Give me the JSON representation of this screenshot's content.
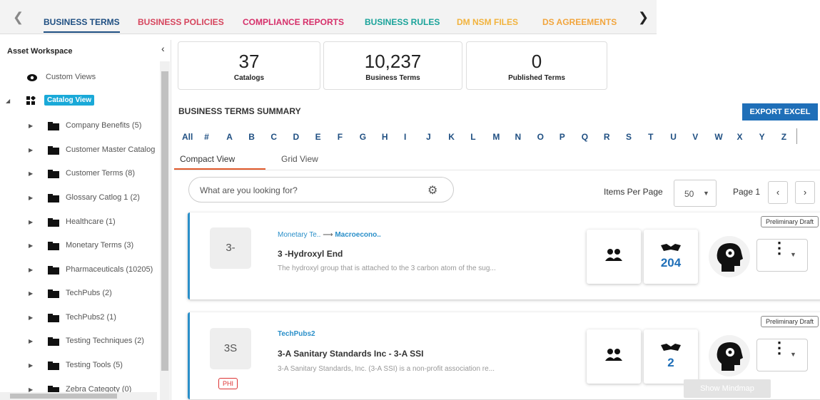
{
  "tabs": [
    {
      "label": "BUSINESS TERMS",
      "color": "#1f4f82"
    },
    {
      "label": "BUSINESS POLICIES",
      "color": "#d6455d"
    },
    {
      "label": "COMPLIANCE REPORTS",
      "color": "#d6306a"
    },
    {
      "label": "BUSINESS RULES",
      "color": "#1aa39a"
    },
    {
      "label": "DM NSM FILES",
      "color": "#f2b33d"
    },
    {
      "label": "DS AGREEMENTS",
      "color": "#f2a53d"
    }
  ],
  "sidebar": {
    "title": "Asset Workspace",
    "custom_views": "Custom Views",
    "catalog_view": "Catalog View",
    "items": [
      "Company Benefits (5)",
      "Customer Master Catalog",
      "Customer Terms (8)",
      "Glossary Catlog 1 (2)",
      "Healthcare (1)",
      "Monetary Terms (3)",
      "Pharmaceuticals (10205)",
      "TechPubs (2)",
      "TechPubs2 (1)",
      "Testing Techniques (2)",
      "Testing Tools (5)",
      "Zebra Categoty (0)"
    ]
  },
  "stats": [
    {
      "value": "37",
      "label": "Catalogs"
    },
    {
      "value": "10,237",
      "label": "Business Terms"
    },
    {
      "value": "0",
      "label": "Published Terms"
    }
  ],
  "summary": {
    "title": "BUSINESS TERMS SUMMARY",
    "export_label": "EXPORT EXCEL"
  },
  "alphabet": [
    "All",
    "#",
    "A",
    "B",
    "C",
    "D",
    "E",
    "F",
    "G",
    "H",
    "I",
    "J",
    "K",
    "L",
    "M",
    "N",
    "O",
    "P",
    "Q",
    "R",
    "S",
    "T",
    "U",
    "V",
    "W",
    "X",
    "Y",
    "Z"
  ],
  "view_tabs": [
    "Compact View",
    "Grid View"
  ],
  "search": {
    "placeholder": "What are you looking for?"
  },
  "pagination": {
    "items_per_page_label": "Items Per Page",
    "items_per_page": "50",
    "page_label": "Page 1"
  },
  "cards": [
    {
      "avatar": "3-",
      "crumb_parent": "Monetary Te..",
      "crumb_child": "Macroecono..",
      "title": "3 -Hydroxyl End",
      "description": "The hydroxyl group that is attached to the 3 carbon atom of the sug...",
      "status": "Preliminary Draft",
      "stewards_count": "204"
    },
    {
      "avatar": "3S",
      "crumb_parent": "",
      "crumb_child": "TechPubs2",
      "title": "3-A Sanitary Standards Inc - 3-A SSI",
      "description": "3-A Sanitary Standards, Inc. (3-A SSI) is a non-profit association re...",
      "status": "Preliminary Draft",
      "stewards_count": "2",
      "tag": "PHI"
    }
  ],
  "tooltip": "Show Mindmap",
  "colors": {
    "accent": "#1f6fb8",
    "card_border": "#2a8fc9",
    "tab_underline": "#e05a2b"
  }
}
